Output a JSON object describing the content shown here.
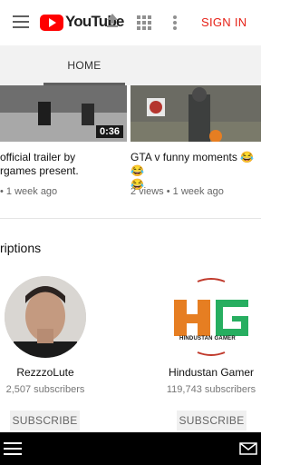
{
  "header": {
    "logo_text": "YouTube",
    "signin_label": "SIGN IN",
    "brand_color": "#ff0000",
    "menu_icon": "hamburger-menu-icon",
    "upload_icon": "upload-icon",
    "apps_icon": "apps-grid-icon",
    "more_icon": "more-vert-icon"
  },
  "tabs": [
    {
      "label": "HOME",
      "active": true
    }
  ],
  "videos": [
    {
      "duration": "0:36",
      "title_line1": "official trailer by",
      "title_line2": "rgames present.",
      "meta": "• 1 week ago"
    },
    {
      "title_line1": "GTA v funny moments 😂😂",
      "title_line2": "😂",
      "meta": "2 views • 1 week ago"
    }
  ],
  "section": {
    "heading": "riptions"
  },
  "channels": [
    {
      "name": "RezzzoLute",
      "subscribers": "2,507 subscribers",
      "button": "SUBSCRIBE"
    },
    {
      "name": "Hindustan Gamer",
      "subscribers": "119,743 subscribers",
      "button": "SUBSCRIBE",
      "logo_text": "HINDUSTAN GAMER"
    }
  ],
  "bottom_bar": {
    "menu_icon": "hamburger-menu-icon",
    "mail_icon": "mail-icon"
  }
}
